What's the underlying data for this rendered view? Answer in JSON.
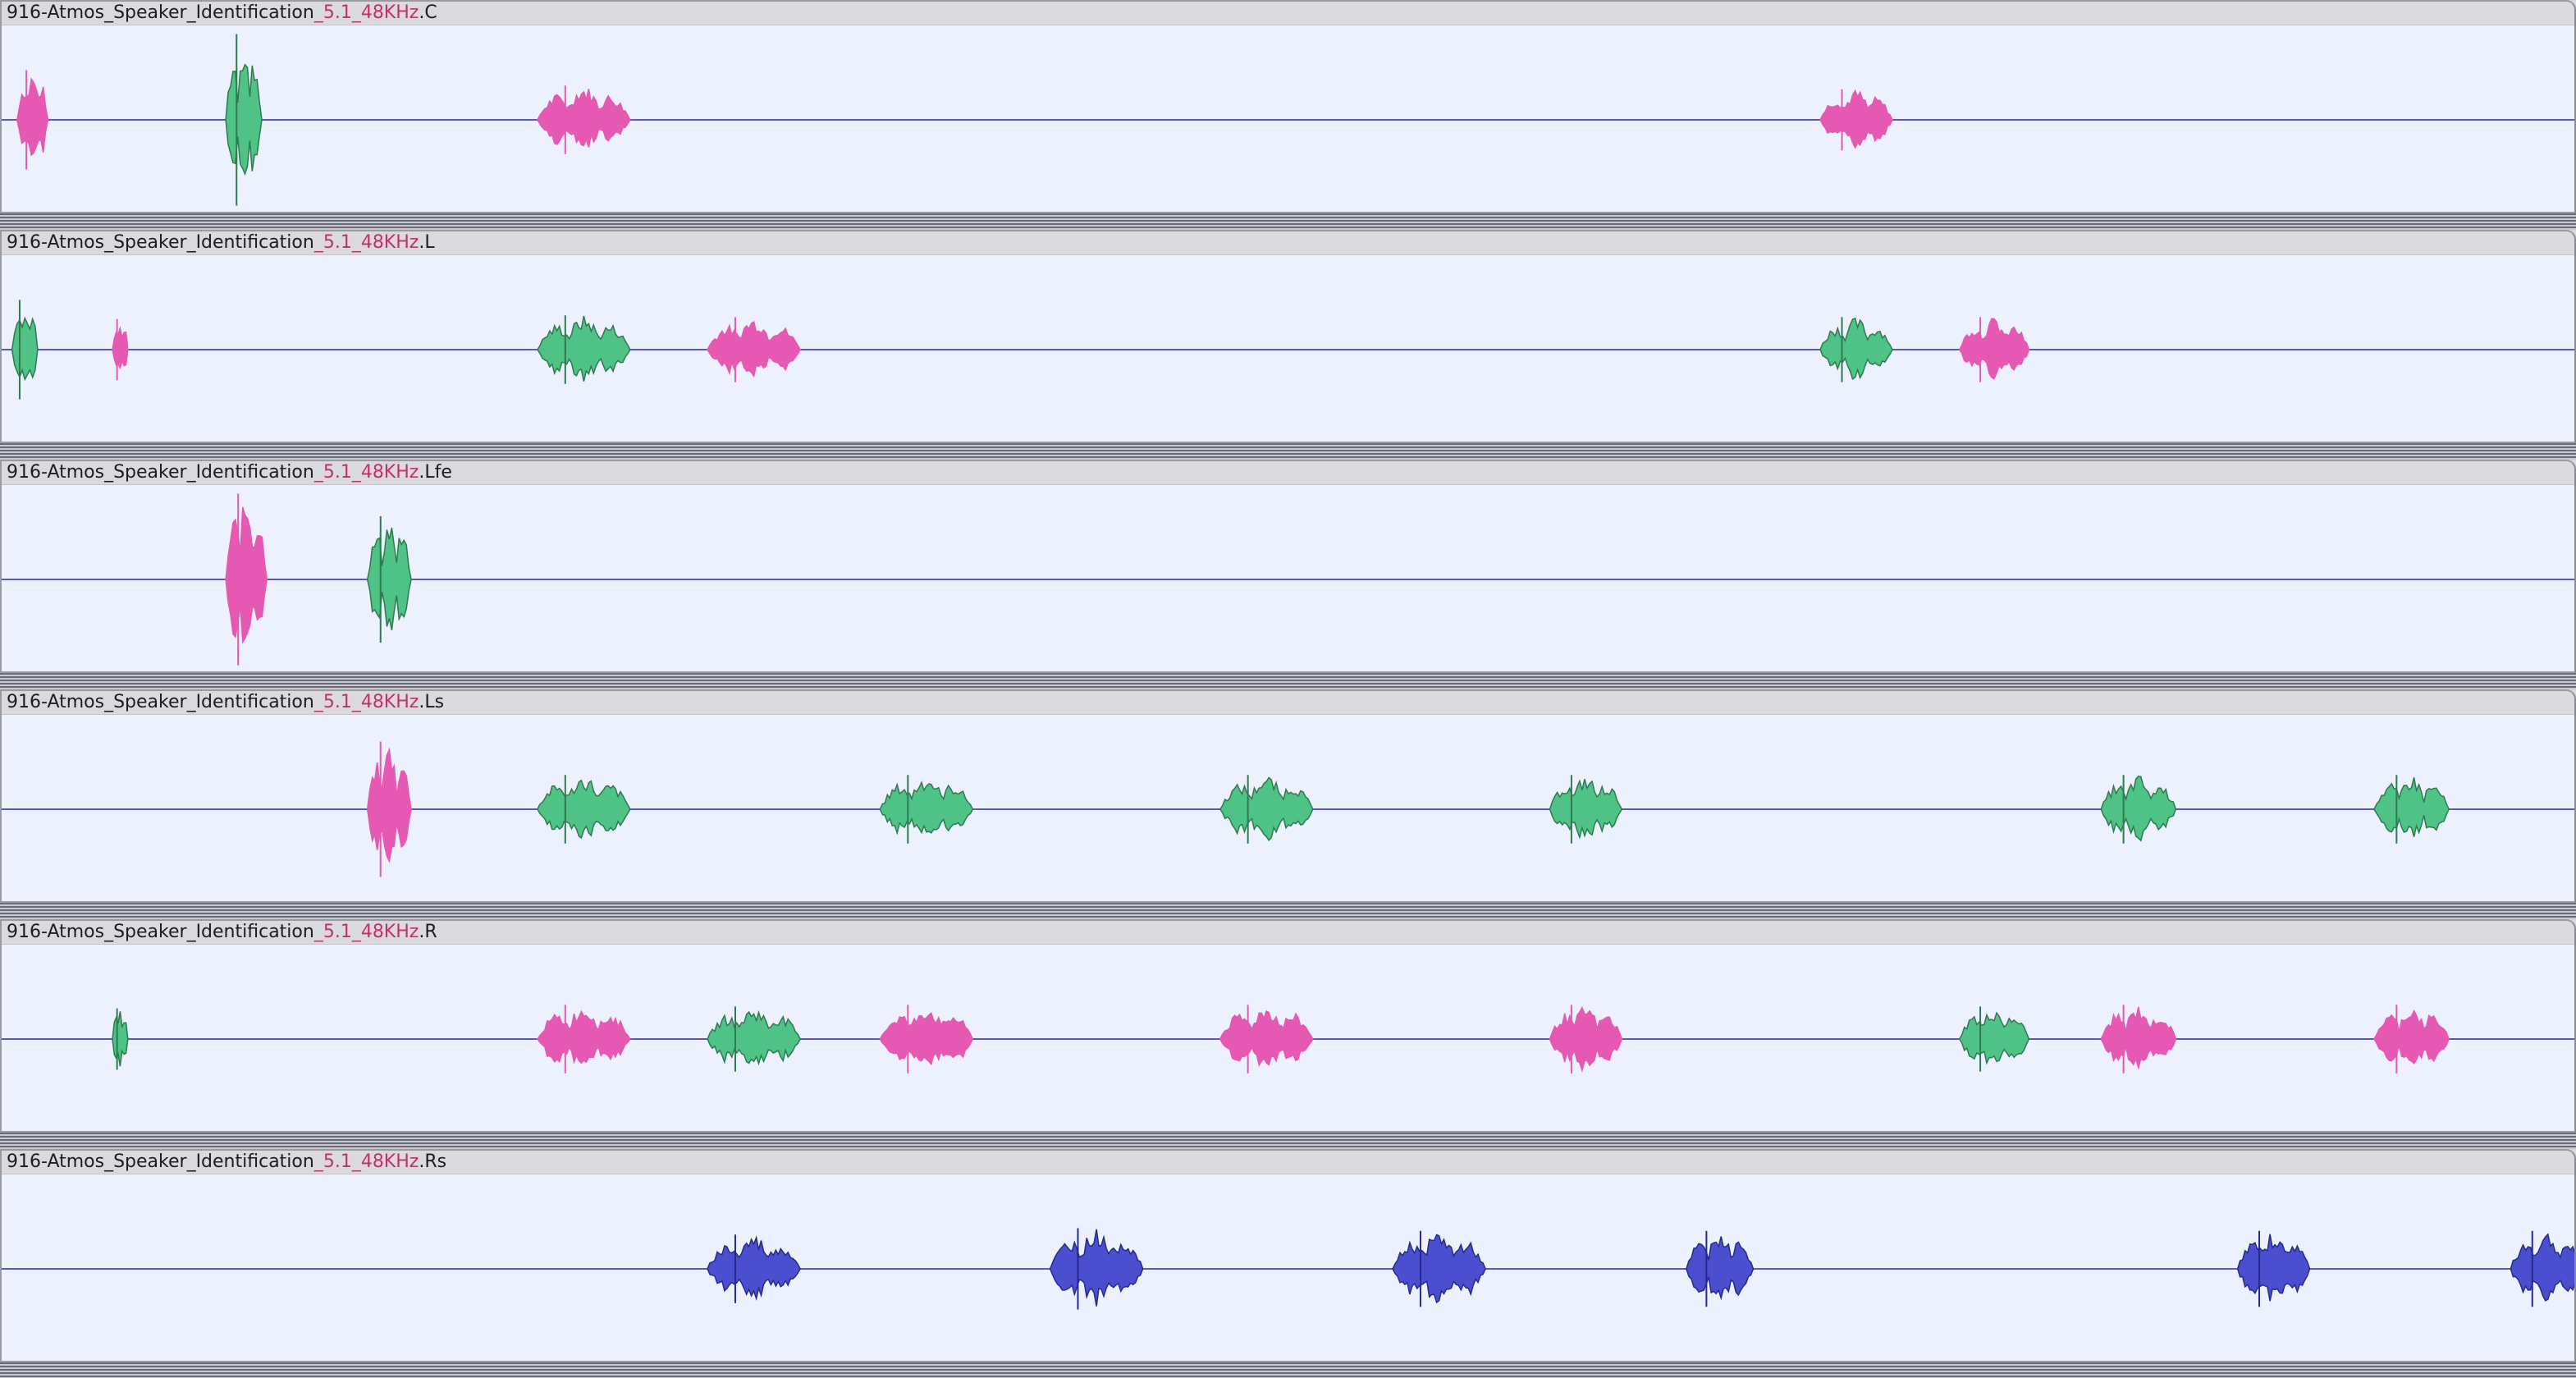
{
  "colors": {
    "track_bg": "#ecf1fd",
    "name_bar": "#dadadd",
    "baseline": "#5a5ab4",
    "pink": "#e659b2",
    "green": "#4fc385",
    "green_dark": "#2f7a4e",
    "blue": "#4a4fd0",
    "blue_dark": "#262a8c"
  },
  "tracks": [
    {
      "prefix": "916-Atmos_Speaker_Identification",
      "overlap": "_5.1_48KHz",
      "suffix": ".C",
      "clips": [
        {
          "t": 0.006,
          "w": 0.012,
          "c": "pink",
          "a": 0.55
        },
        {
          "t": 0.087,
          "w": 0.014,
          "c": "green",
          "a": 0.95
        },
        {
          "t": 0.208,
          "w": 0.036,
          "c": "pink",
          "a": 0.38
        },
        {
          "t": 0.706,
          "w": 0.028,
          "c": "pink",
          "a": 0.34
        }
      ]
    },
    {
      "prefix": "916-Atmos_Speaker_Identification",
      "overlap": "_5.1_48KHz",
      "suffix": ".L",
      "clips": [
        {
          "t": 0.004,
          "w": 0.01,
          "c": "green",
          "a": 0.55
        },
        {
          "t": 0.043,
          "w": 0.006,
          "c": "pink",
          "a": 0.34
        },
        {
          "t": 0.208,
          "w": 0.036,
          "c": "green",
          "a": 0.38
        },
        {
          "t": 0.274,
          "w": 0.036,
          "c": "pink",
          "a": 0.36
        },
        {
          "t": 0.706,
          "w": 0.028,
          "c": "green",
          "a": 0.36
        },
        {
          "t": 0.76,
          "w": 0.027,
          "c": "pink",
          "a": 0.36
        }
      ]
    },
    {
      "prefix": "916-Atmos_Speaker_Identification",
      "overlap": "_5.1_48KHz",
      "suffix": ".Lfe",
      "clips": [
        {
          "t": 0.087,
          "w": 0.016,
          "c": "pink",
          "a": 0.95
        },
        {
          "t": 0.142,
          "w": 0.017,
          "c": "green",
          "a": 0.7
        }
      ]
    },
    {
      "prefix": "916-Atmos_Speaker_Identification",
      "overlap": "_5.1_48KHz",
      "suffix": ".Ls",
      "clips": [
        {
          "t": 0.142,
          "w": 0.017,
          "c": "pink",
          "a": 0.75
        },
        {
          "t": 0.208,
          "w": 0.036,
          "c": "green",
          "a": 0.38
        },
        {
          "t": 0.341,
          "w": 0.036,
          "c": "green",
          "a": 0.38
        },
        {
          "t": 0.473,
          "w": 0.036,
          "c": "green",
          "a": 0.38
        },
        {
          "t": 0.601,
          "w": 0.028,
          "c": "green",
          "a": 0.38
        },
        {
          "t": 0.815,
          "w": 0.029,
          "c": "green",
          "a": 0.38
        },
        {
          "t": 0.921,
          "w": 0.029,
          "c": "green",
          "a": 0.38
        }
      ]
    },
    {
      "prefix": "916-Atmos_Speaker_Identification",
      "overlap": "_5.1_48KHz",
      "suffix": ".R",
      "clips": [
        {
          "t": 0.043,
          "w": 0.006,
          "c": "green",
          "a": 0.34
        },
        {
          "t": 0.208,
          "w": 0.036,
          "c": "pink",
          "a": 0.38
        },
        {
          "t": 0.274,
          "w": 0.036,
          "c": "green",
          "a": 0.36
        },
        {
          "t": 0.341,
          "w": 0.036,
          "c": "pink",
          "a": 0.38
        },
        {
          "t": 0.473,
          "w": 0.036,
          "c": "pink",
          "a": 0.38
        },
        {
          "t": 0.601,
          "w": 0.028,
          "c": "pink",
          "a": 0.38
        },
        {
          "t": 0.76,
          "w": 0.027,
          "c": "green",
          "a": 0.36
        },
        {
          "t": 0.815,
          "w": 0.029,
          "c": "pink",
          "a": 0.38
        },
        {
          "t": 0.921,
          "w": 0.029,
          "c": "pink",
          "a": 0.38
        }
      ]
    },
    {
      "prefix": "916-Atmos_Speaker_Identification",
      "overlap": "_5.1_48KHz",
      "suffix": ".Rs",
      "clips": [
        {
          "t": 0.274,
          "w": 0.036,
          "c": "blue",
          "a": 0.38
        },
        {
          "t": 0.407,
          "w": 0.036,
          "c": "blue",
          "a": 0.45
        },
        {
          "t": 0.54,
          "w": 0.036,
          "c": "blue",
          "a": 0.42
        },
        {
          "t": 0.654,
          "w": 0.026,
          "c": "blue",
          "a": 0.42
        },
        {
          "t": 0.868,
          "w": 0.028,
          "c": "blue",
          "a": 0.42
        },
        {
          "t": 0.974,
          "w": 0.028,
          "c": "blue",
          "a": 0.42
        }
      ]
    }
  ]
}
